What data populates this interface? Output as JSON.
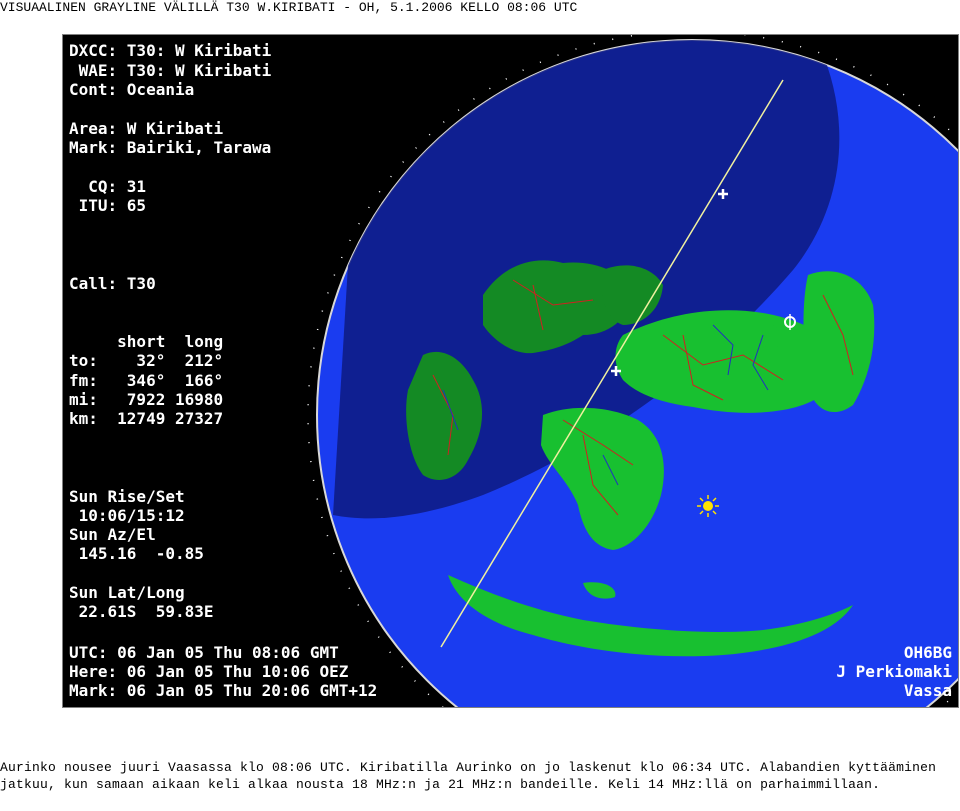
{
  "header": {
    "title": "VISUAALINEN GRAYLINE VÄLILLÄ T30 W.KIRIBATI - OH, 5.1.2006 KELLO 08:06 UTC"
  },
  "panel": {
    "dxcc": "DXCC: T30: W Kiribati",
    "wae": " WAE: T30: W Kiribati",
    "cont": "Cont: Oceania",
    "area": "Area: W Kiribati",
    "mark": "Mark: Bairiki, Tarawa",
    "cq": "  CQ: 31",
    "itu": " ITU: 65",
    "call": "Call: T30",
    "path_header": "     short  long",
    "to": "to:    32°  212°",
    "fm": "fm:   346°  166°",
    "mi": "mi:   7922 16980",
    "km": "km:  12749 27327",
    "sun_rise_label": "Sun Rise/Set",
    "sun_rise_value": " 10:06/15:12",
    "sun_az_label": "Sun Az/El",
    "sun_az_value": " 145.16  -0.85",
    "sun_latlong_label": "Sun Lat/Long",
    "sun_latlong_value": " 22.61S  59.83E",
    "utc": "UTC: 06 Jan 05 Thu 08:06 GMT",
    "here": "Here: 06 Jan 05 Thu 10:06 OEZ",
    "mark_time": "Mark: 06 Jan 05 Thu 20:06 GMT+12",
    "station_call": "OH6BG",
    "station_name": "J Perkiomaki",
    "station_location": "Vassa"
  },
  "colors": {
    "ocean": "#1a3cf0",
    "night": "#0e1a80",
    "land": "#18c030",
    "land_night": "#148a24",
    "borders": "#d02020",
    "rivers": "#2030c0"
  },
  "icons": {
    "sun": "sun-icon",
    "home_marker": "cross-marker-icon",
    "target_marker": "crosshair-marker-icon"
  },
  "caption": {
    "text": "Aurinko nousee juuri Vaasassa klo 08:06 UTC. Kiribatilla Aurinko on jo laskenut klo 06:34 UTC. Alabandien kyttääminen jatkuu, kun samaan aikaan keli alkaa nousta 18 MHz:n ja 21 MHz:n bandeille. Keli 14 MHz:llä on parhaimmillaan."
  }
}
